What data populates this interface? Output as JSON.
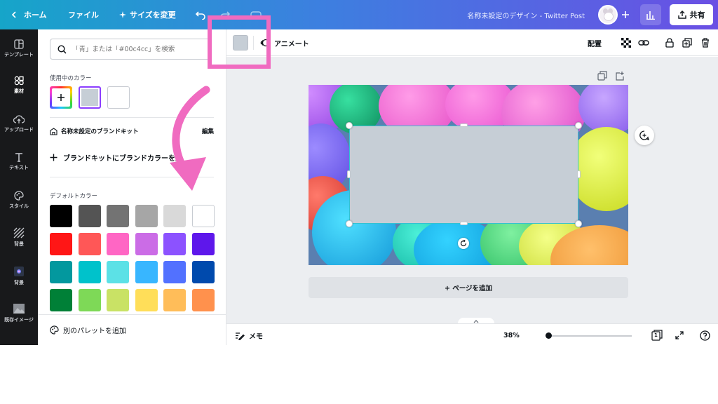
{
  "topbar": {
    "home_label": "ホーム",
    "file_label": "ファイル",
    "resize_label": "サイズを変更",
    "design_title": "名称未設定のデザイン - Twitter Post",
    "share_label": "共有"
  },
  "rail": {
    "items": [
      {
        "label": "テンプレート",
        "icon": "template-icon"
      },
      {
        "label": "素材",
        "icon": "elements-icon"
      },
      {
        "label": "アップロード",
        "icon": "upload-icon"
      },
      {
        "label": "テキスト",
        "icon": "text-icon"
      },
      {
        "label": "スタイル",
        "icon": "style-icon"
      },
      {
        "label": "背景",
        "icon": "background-icon"
      },
      {
        "label": "背景",
        "icon": "background2-icon"
      },
      {
        "label": "既存イメージ",
        "icon": "image-icon"
      }
    ]
  },
  "panel": {
    "search_placeholder": "「青」または「#00c4cc」を検索",
    "in_use_label": "使用中のカラー",
    "in_use_colors": [
      "#c6ced6",
      "#ffffff"
    ],
    "brand_kit_title": "名称未設定のブランドキット",
    "brand_edit": "編集",
    "add_brand_color": "ブランドキットにブランドカラーを追",
    "default_colors_label": "デフォルトカラー",
    "default_colors": [
      "#000000",
      "#545454",
      "#737373",
      "#a6a6a6",
      "#d9d9d9",
      "#ffffff",
      "#ff1616",
      "#ff5757",
      "#ff66c4",
      "#cb6ce6",
      "#8c52ff",
      "#5e17eb",
      "#03989e",
      "#00c2cb",
      "#5ce1e6",
      "#38b6ff",
      "#5271ff",
      "#004aad",
      "#008037",
      "#7ed957",
      "#c9e265",
      "#ffde59",
      "#ffbd59",
      "#ff914d"
    ],
    "add_palette_label": "別のパレットを追加"
  },
  "toolbar": {
    "current_color": "#c6ced6",
    "animate_label": "アニメート",
    "position_label": "配置"
  },
  "canvas": {
    "add_page_label": "+ ページを追加"
  },
  "bottombar": {
    "notes_label": "メモ",
    "zoom_label": "38%",
    "page_count": "1",
    "zoom_level": 0.38
  },
  "annotation": {
    "highlight_color": "#f06bc0"
  }
}
